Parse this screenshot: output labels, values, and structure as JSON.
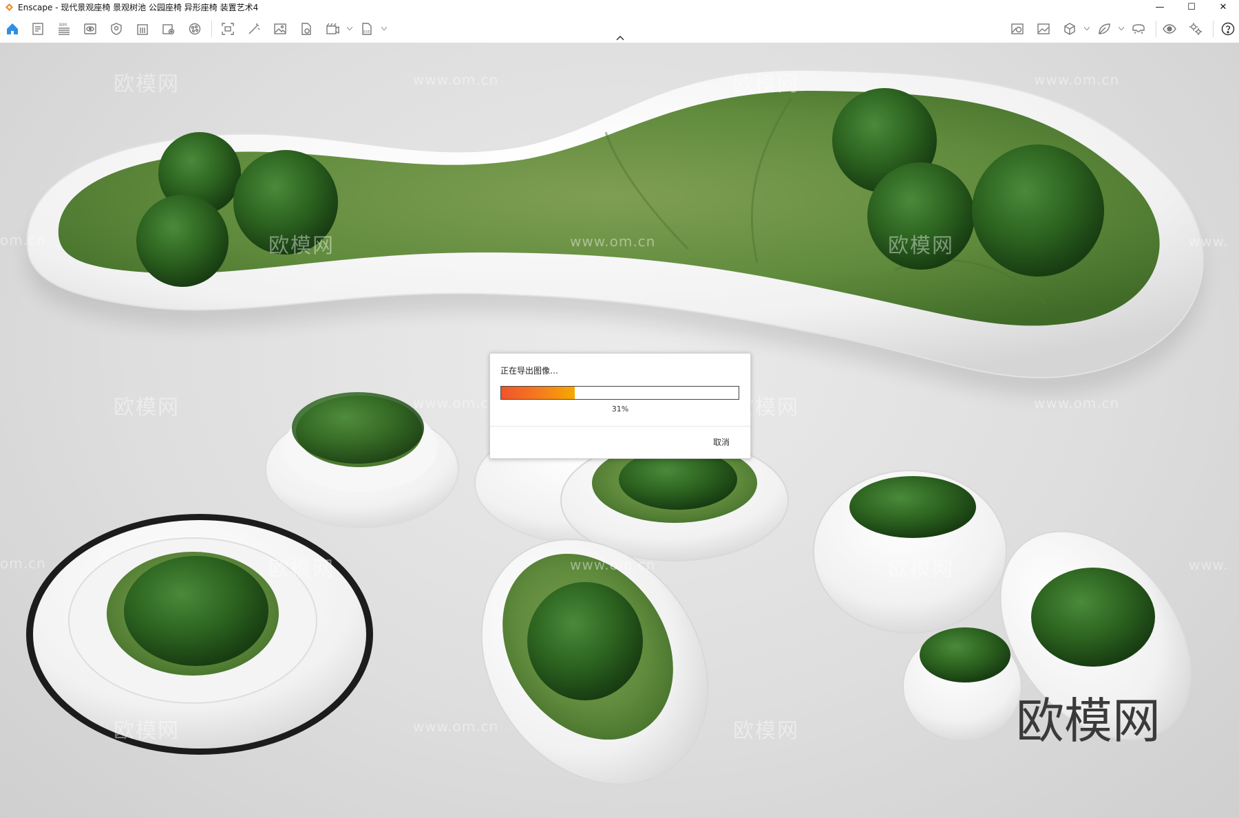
{
  "window": {
    "title": "Enscape - 现代景观座椅 景观树池 公园座椅 异形座椅 装置艺术4",
    "accent_color": "#f08a1c",
    "controls": [
      {
        "name": "minimize",
        "glyph": "—"
      },
      {
        "name": "maximize",
        "glyph": "☐"
      },
      {
        "name": "close",
        "glyph": "✕"
      }
    ]
  },
  "toolbar": {
    "left_icons": [
      "home-icon",
      "document-icon",
      "bim-icon",
      "view-icon",
      "shield-icon",
      "building-icon",
      "image-settings-icon",
      "material-icon",
      "screenshot-icon",
      "magic-wand-icon",
      "image-icon",
      "export-file-icon",
      "video-icon",
      "exe-file-icon"
    ],
    "right_icons": [
      "map-icon",
      "landscape-icon",
      "cube-icon",
      "leaf-icon",
      "vr-headset-icon",
      "eye-icon",
      "settings-icon",
      "help-icon"
    ],
    "bim_label": "BIM",
    "exe_label": "EXE"
  },
  "viewport": {
    "watermark_logo": "欧模网",
    "watermark_url": "www.om.cn",
    "watermark_url_partial": "om.cn",
    "watermark_url_edge": "www.",
    "brand_watermark": "欧模网"
  },
  "export_dialog": {
    "title": "正在导出图像…",
    "progress_fraction": 0.31,
    "progress_text": "31%",
    "cancel_label": "取消"
  }
}
